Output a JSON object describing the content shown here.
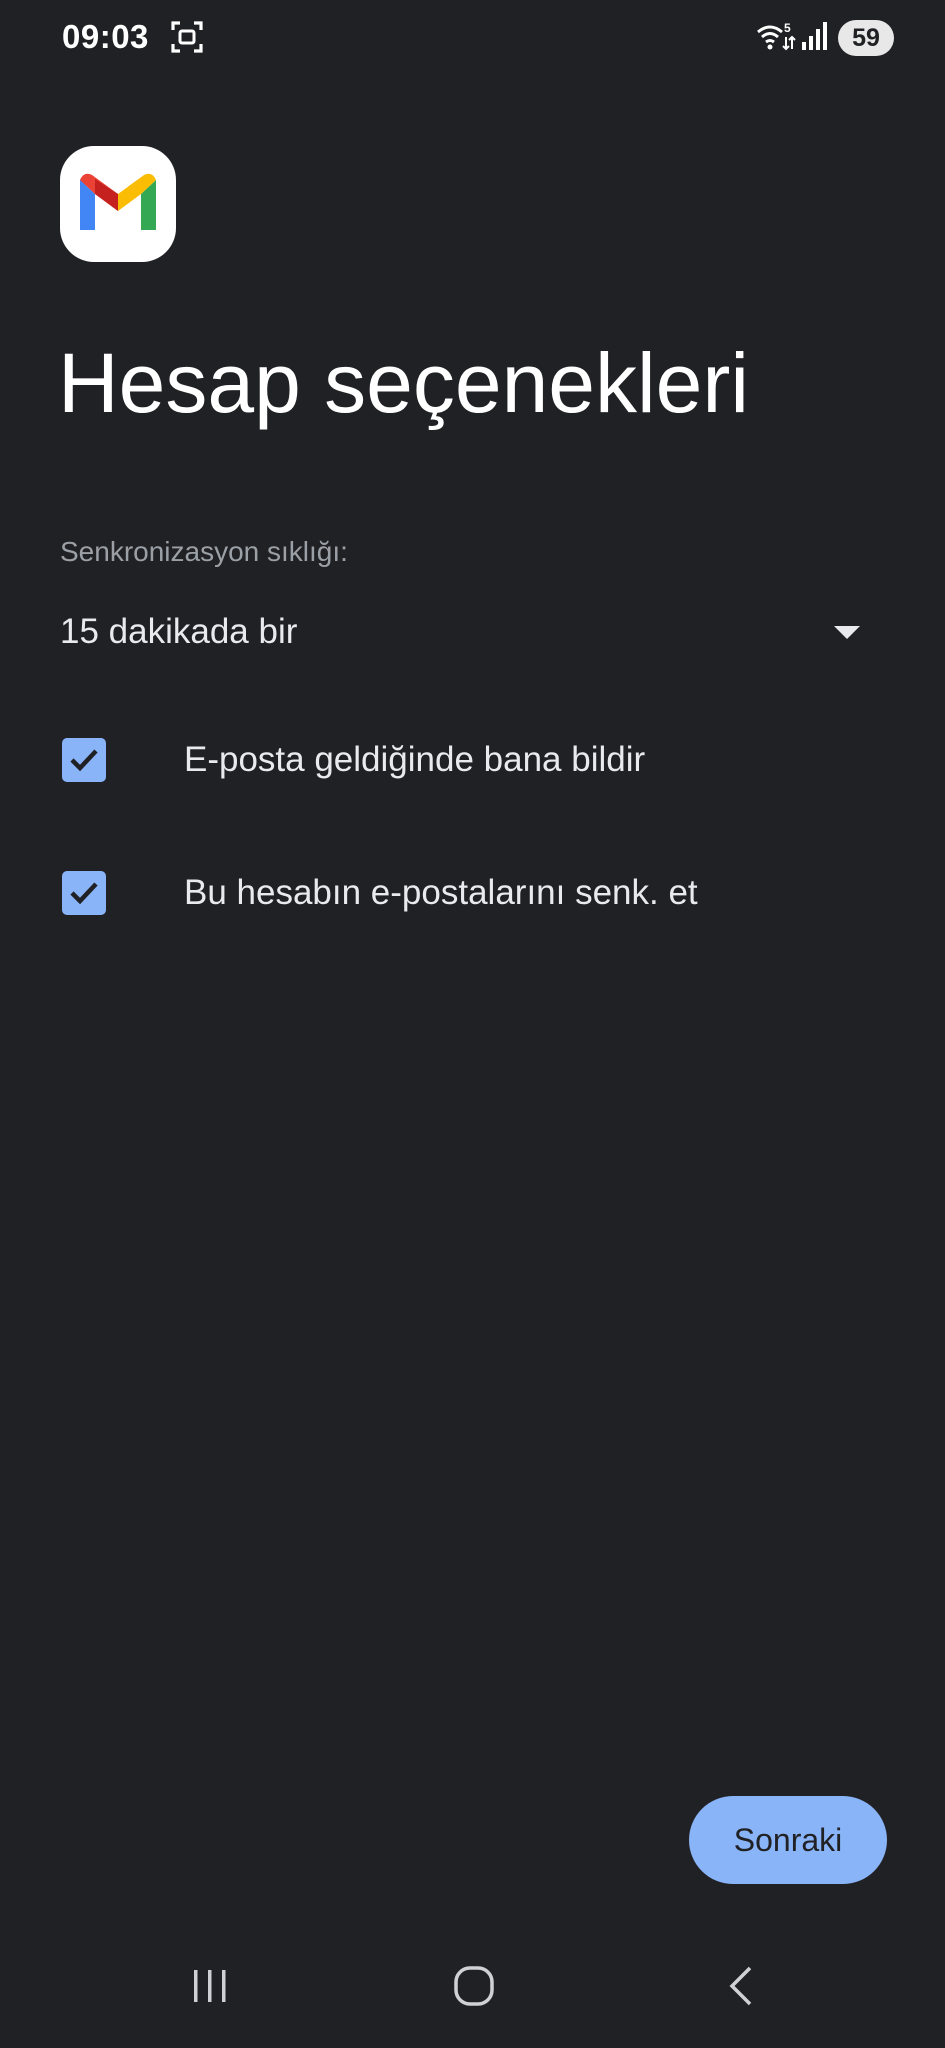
{
  "status_bar": {
    "time": "09:03",
    "battery": "59",
    "icons": [
      "screenshot-icon",
      "wifi-icon",
      "signal-icon"
    ]
  },
  "app": {
    "icon": "gmail-logo"
  },
  "page": {
    "title": "Hesap seçenekleri"
  },
  "sync": {
    "label": "Senkronizasyon sıklığı:",
    "selected": "15 dakikada bir"
  },
  "options": [
    {
      "label": "E-posta geldiğinde bana bildir",
      "checked": true
    },
    {
      "label": "Bu hesabın e-postalarını senk. et",
      "checked": true
    }
  ],
  "actions": {
    "next_label": "Sonraki"
  },
  "nav": {
    "items": [
      "recents-icon",
      "home-icon",
      "back-icon"
    ]
  },
  "colors": {
    "background": "#202124",
    "accent": "#8ab4f8",
    "text": "#e8eaed",
    "secondary_text": "#9aa0a6"
  }
}
